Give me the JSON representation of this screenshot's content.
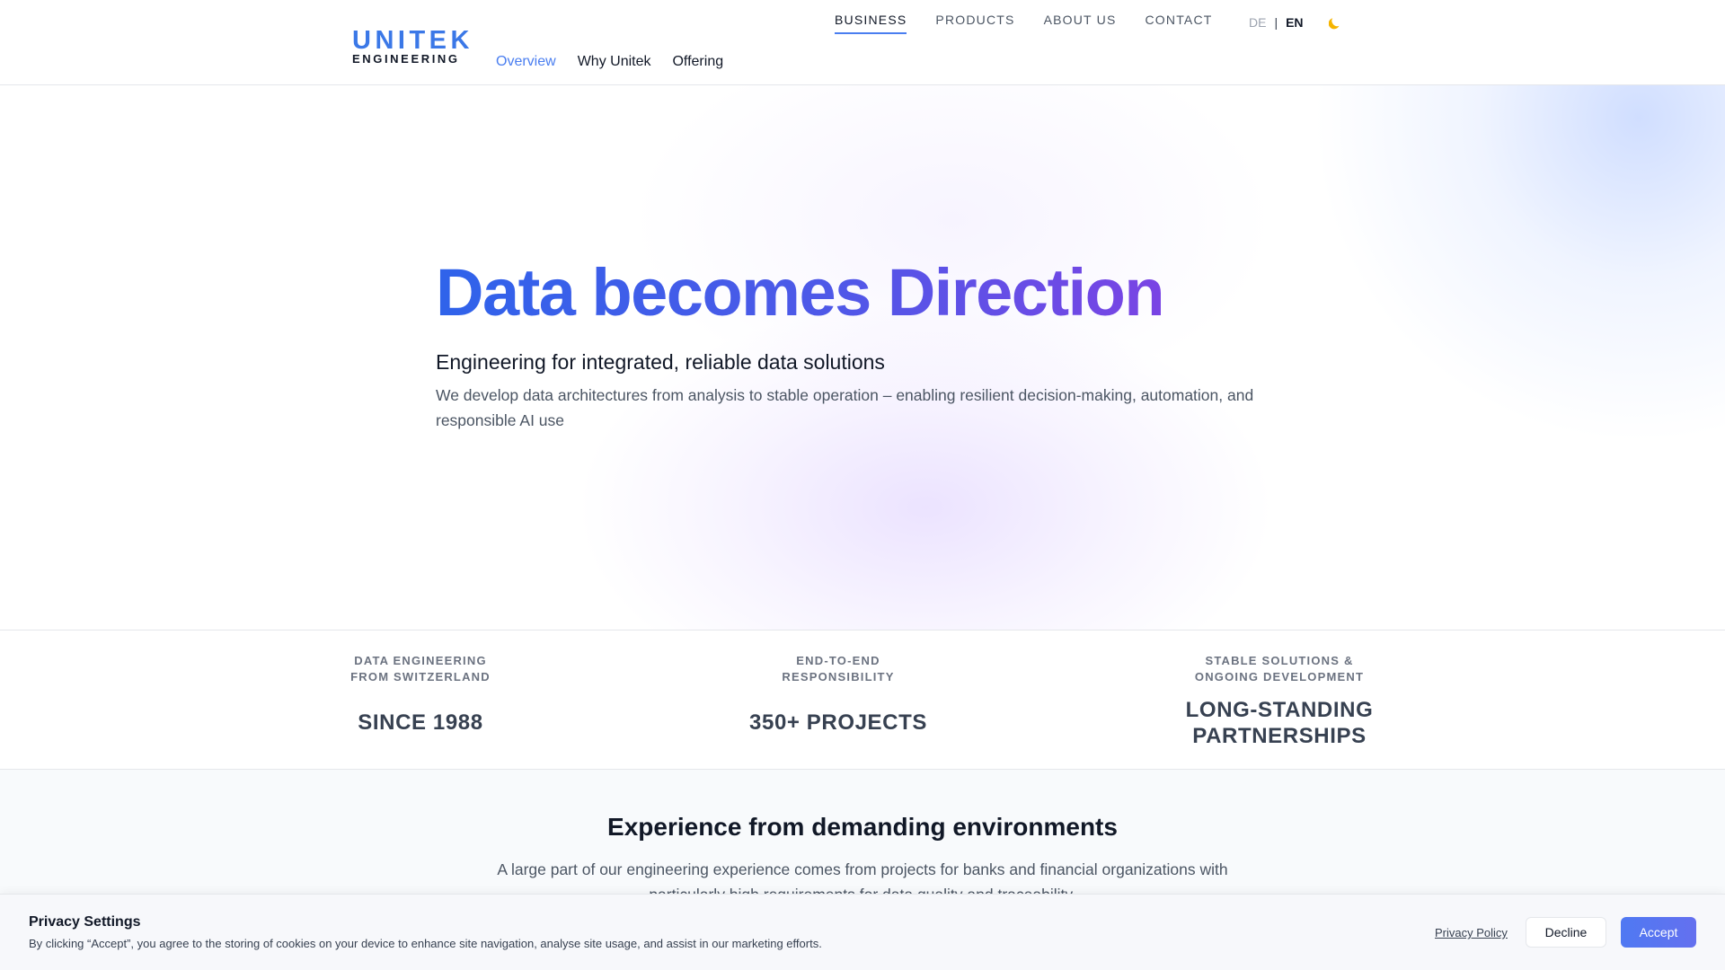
{
  "header": {
    "logo": {
      "top": "UNITEK",
      "bottom": "ENGINEERING"
    },
    "subnav": [
      {
        "label": "Overview",
        "active": true
      },
      {
        "label": "Why Unitek",
        "active": false
      },
      {
        "label": "Offering",
        "active": false
      }
    ],
    "mainnav": [
      {
        "label": "BUSINESS",
        "active": true
      },
      {
        "label": "PRODUCTS",
        "active": false
      },
      {
        "label": "ABOUT US",
        "active": false
      },
      {
        "label": "CONTACT",
        "active": false
      }
    ],
    "language": {
      "de": "DE",
      "separator": "|",
      "en": "EN",
      "selected": "EN"
    },
    "theme_icon": "moon-icon"
  },
  "hero": {
    "title": "Data becomes Direction",
    "subtitle": "Engineering for integrated, reliable data solutions",
    "description": "We develop data architectures from analysis to stable operation – enabling resilient decision-making, automation, and responsible AI use"
  },
  "stats": [
    {
      "label_line1": "DATA ENGINEERING",
      "label_line2": "FROM SWITZERLAND",
      "value_line1": "SINCE 1988",
      "value_line2": ""
    },
    {
      "label_line1": "END-TO-END",
      "label_line2": "RESPONSIBILITY",
      "value_line1": "350+ PROJECTS",
      "value_line2": ""
    },
    {
      "label_line1": "STABLE SOLUTIONS &",
      "label_line2": "ONGOING DEVELOPMENT",
      "value_line1": "LONG-STANDING",
      "value_line2": "PARTNERSHIPS"
    }
  ],
  "experience": {
    "title": "Experience from demanding environments",
    "description": "A large part of our engineering experience comes from projects for banks and financial organizations with particularly high requirements for data quality and traceability."
  },
  "cookie": {
    "title": "Privacy Settings",
    "text": "By clicking “Accept”, you agree to the storing of cookies on your device to enhance site navigation, analyse site usage, and assist in our marketing efforts.",
    "policy_link": "Privacy Policy",
    "decline_label": "Decline",
    "accept_label": "Accept"
  },
  "colors": {
    "brand_blue": "#3b78e7",
    "accent": "#4a7ef0",
    "gradient_start": "#2f63ea",
    "gradient_end": "#7a44e4",
    "accept_button": "#5a75f0"
  }
}
